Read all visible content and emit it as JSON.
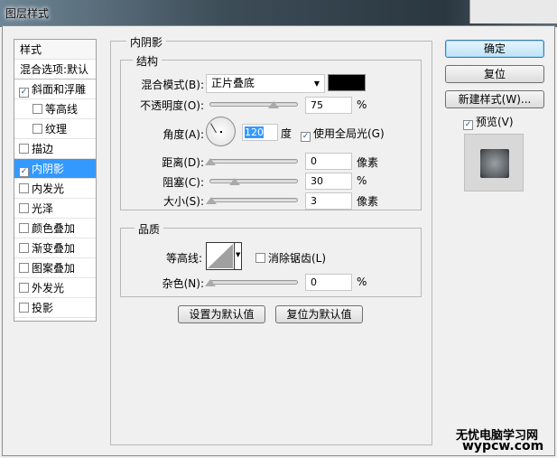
{
  "window": {
    "title": "图层样式"
  },
  "styles_list": {
    "header": "样式",
    "blend_options": "混合选项:默认",
    "items": [
      {
        "label": "斜面和浮雕",
        "checked": true,
        "indent": false
      },
      {
        "label": "等高线",
        "checked": false,
        "indent": true
      },
      {
        "label": "纹理",
        "checked": false,
        "indent": true
      },
      {
        "label": "描边",
        "checked": false,
        "indent": false
      },
      {
        "label": "内阴影",
        "checked": true,
        "indent": false,
        "selected": true
      },
      {
        "label": "内发光",
        "checked": false,
        "indent": false
      },
      {
        "label": "光泽",
        "checked": false,
        "indent": false
      },
      {
        "label": "颜色叠加",
        "checked": false,
        "indent": false
      },
      {
        "label": "渐变叠加",
        "checked": false,
        "indent": false
      },
      {
        "label": "图案叠加",
        "checked": false,
        "indent": false
      },
      {
        "label": "外发光",
        "checked": false,
        "indent": false
      },
      {
        "label": "投影",
        "checked": false,
        "indent": false
      }
    ]
  },
  "panel": {
    "title": "内阴影",
    "structure": {
      "title": "结构",
      "blend_mode_label": "混合模式(B):",
      "blend_mode_value": "正片叠底",
      "shadow_color": "#000000",
      "opacity_label": "不透明度(O):",
      "opacity_value": "75",
      "opacity_unit": "%",
      "angle_label": "角度(A):",
      "angle_value": "120",
      "angle_unit": "度",
      "global_light_label": "使用全局光(G)",
      "global_light_checked": true,
      "distance_label": "距离(D):",
      "distance_value": "0",
      "distance_unit": "像素",
      "choke_label": "阻塞(C):",
      "choke_value": "30",
      "choke_unit": "%",
      "size_label": "大小(S):",
      "size_value": "3",
      "size_unit": "像素"
    },
    "quality": {
      "title": "品质",
      "contour_label": "等高线:",
      "antialias_label": "消除锯齿(L)",
      "antialias_checked": false,
      "noise_label": "杂色(N):",
      "noise_value": "0",
      "noise_unit": "%"
    },
    "make_default": "设置为默认值",
    "reset_default": "复位为默认值"
  },
  "buttons": {
    "ok": "确定",
    "reset": "复位",
    "new_style": "新建样式(W)...",
    "preview_label": "预览(V)",
    "preview_checked": true
  },
  "watermark": {
    "line1": "无忧电脑学习网",
    "line2": "wypcw.com"
  }
}
